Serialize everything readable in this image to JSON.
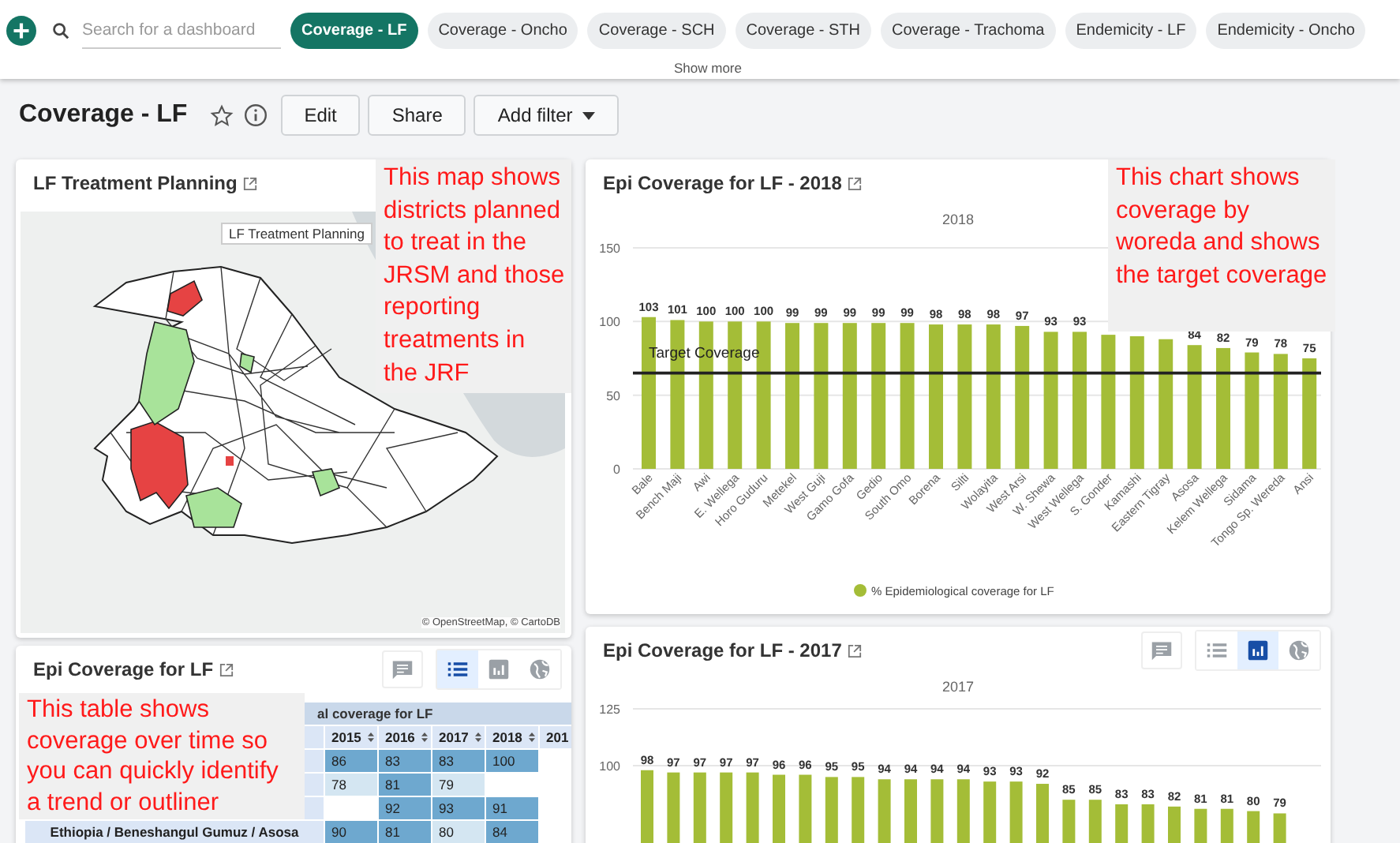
{
  "header": {
    "search": {
      "placeholder": "Search for a dashboard"
    },
    "tabs": [
      {
        "label": "Coverage - LF",
        "selected": true
      },
      {
        "label": "Coverage - Oncho",
        "selected": false
      },
      {
        "label": "Coverage - SCH",
        "selected": false
      },
      {
        "label": "Coverage - STH",
        "selected": false
      },
      {
        "label": "Coverage - Trachoma",
        "selected": false
      },
      {
        "label": "Endemicity - LF",
        "selected": false
      },
      {
        "label": "Endemicity - Oncho",
        "selected": false
      }
    ],
    "show_more": "Show more"
  },
  "dashboard": {
    "title": "Coverage - LF",
    "starred": false,
    "buttons": [
      {
        "label": "Edit",
        "kind": "plain"
      },
      {
        "label": "Share",
        "kind": "plain"
      },
      {
        "label": "Add filter",
        "kind": "dropdown"
      }
    ]
  },
  "map_panel": {
    "title": "LF Treatment Planning",
    "tooltip": "LF Treatment Planning",
    "attribution": "© OpenStreetMap, © CartoDB",
    "note": "This map shows districts planned to treat in the JRSM and those reporting treatments in the JRF"
  },
  "table_panel": {
    "title": "Epi Coverage for LF",
    "views": [
      {
        "kind": "list",
        "selected": true
      },
      {
        "kind": "bar",
        "selected": false
      },
      {
        "kind": "globe",
        "selected": false
      }
    ],
    "group_header": "al coverage for LF",
    "columns": [
      "2015",
      "2016",
      "2017",
      "2018",
      "201"
    ],
    "rows": [
      {
        "cells": [
          "86",
          "83",
          "83",
          "100",
          ""
        ]
      },
      {
        "cells": [
          "78",
          "81",
          "79",
          "",
          ""
        ]
      },
      {
        "cells": [
          "",
          "92",
          "93",
          "91",
          ""
        ]
      },
      {
        "label": "Ethiopia / Beneshangul Gumuz / Asosa",
        "cells": [
          "90",
          "81",
          "80",
          "84",
          ""
        ]
      }
    ],
    "note": "This table shows coverage over time so you can quickly identify a trend or outliner"
  },
  "chart_panels": [
    {
      "title": "Epi Coverage for LF - 2018",
      "note": "This chart shows coverage by woreda and shows the target coverage",
      "chart_data": {
        "type": "bar",
        "title": "2018",
        "categories": [
          "Bale",
          "Bench Maji",
          "Awi",
          "E. Wellega",
          "Horo Guduru",
          "Metekel",
          "West Guji",
          "Gamo Gofa",
          "Gedio",
          "South Omo",
          "Borena",
          "Silti",
          "Wolayita",
          "West Arsi",
          "W. Shewa",
          "West Wellega",
          "S. Gonder",
          "Kamashi",
          "Eastern Tigray",
          "Asosa",
          "Kelem Wellega",
          "Sidama",
          "Tongo Sp. Wereda",
          "Ansi"
        ],
        "series": [
          {
            "name": "% Epidemiological coverage for LF",
            "color": "#a4bd37",
            "values": [
              103,
              101,
              100,
              100,
              100,
              99,
              99,
              99,
              99,
              99,
              98,
              98,
              98,
              97,
              93,
              93,
              91,
              90,
              88,
              84,
              82,
              79,
              78,
              75
            ]
          }
        ],
        "ylim": [
          0,
          150
        ],
        "yticks": [
          0,
          50,
          100,
          150
        ],
        "value_labels": [
          "103",
          "101",
          "100",
          "100",
          "100",
          "99",
          "99",
          "99",
          "99",
          "99",
          "98",
          "98",
          "98",
          "97",
          "93",
          "93",
          null,
          null,
          null,
          "84",
          "82",
          "79",
          "78",
          "75"
        ],
        "ref_lines": [
          {
            "axis": "y",
            "value": 65,
            "label": "Target Coverage"
          }
        ]
      }
    },
    {
      "title": "Epi Coverage for LF - 2017",
      "views": [
        {
          "kind": "list",
          "selected": false
        },
        {
          "kind": "bar",
          "selected": true
        },
        {
          "kind": "globe",
          "selected": false
        }
      ],
      "chart_data": {
        "type": "bar",
        "title": "2017",
        "series": [
          {
            "color": "#a4bd37",
            "values": [
              98,
              97,
              97,
              97,
              97,
              96,
              96,
              95,
              95,
              94,
              94,
              94,
              94,
              93,
              93,
              92,
              85,
              85,
              83,
              83,
              82,
              81,
              81,
              80,
              79
            ]
          }
        ],
        "ylim": [
          0,
          125
        ],
        "yticks": [
          100,
          125
        ],
        "data_labels": true
      }
    }
  ]
}
